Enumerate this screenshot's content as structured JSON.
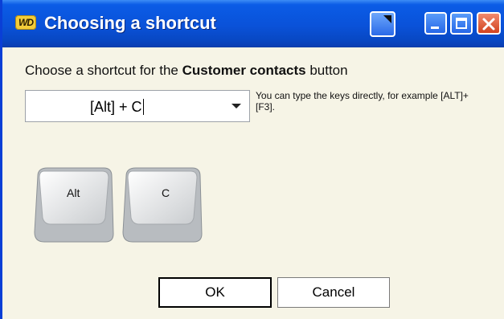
{
  "window": {
    "app_logo": "WD",
    "title": "Choosing a shortcut"
  },
  "dialog": {
    "prompt_prefix": "Choose a shortcut for the ",
    "prompt_target": "Customer contacts",
    "prompt_suffix": " button",
    "shortcut_value": "[Alt] + C",
    "hint": "You can type the keys directly, for example [ALT]+[F3].",
    "keys": [
      {
        "label": "Alt"
      },
      {
        "label": "C"
      }
    ],
    "ok_label": "OK",
    "cancel_label": "Cancel"
  },
  "colors": {
    "titlebar": "#0a52d9",
    "body_background": "#f6f4e6",
    "close_button": "#d2431f"
  },
  "icons": {
    "titlebar_special": "window-menu-icon",
    "minimize": "minimize-icon",
    "maximize": "maximize-icon",
    "close": "close-icon",
    "dropdown": "chevron-down-icon"
  }
}
